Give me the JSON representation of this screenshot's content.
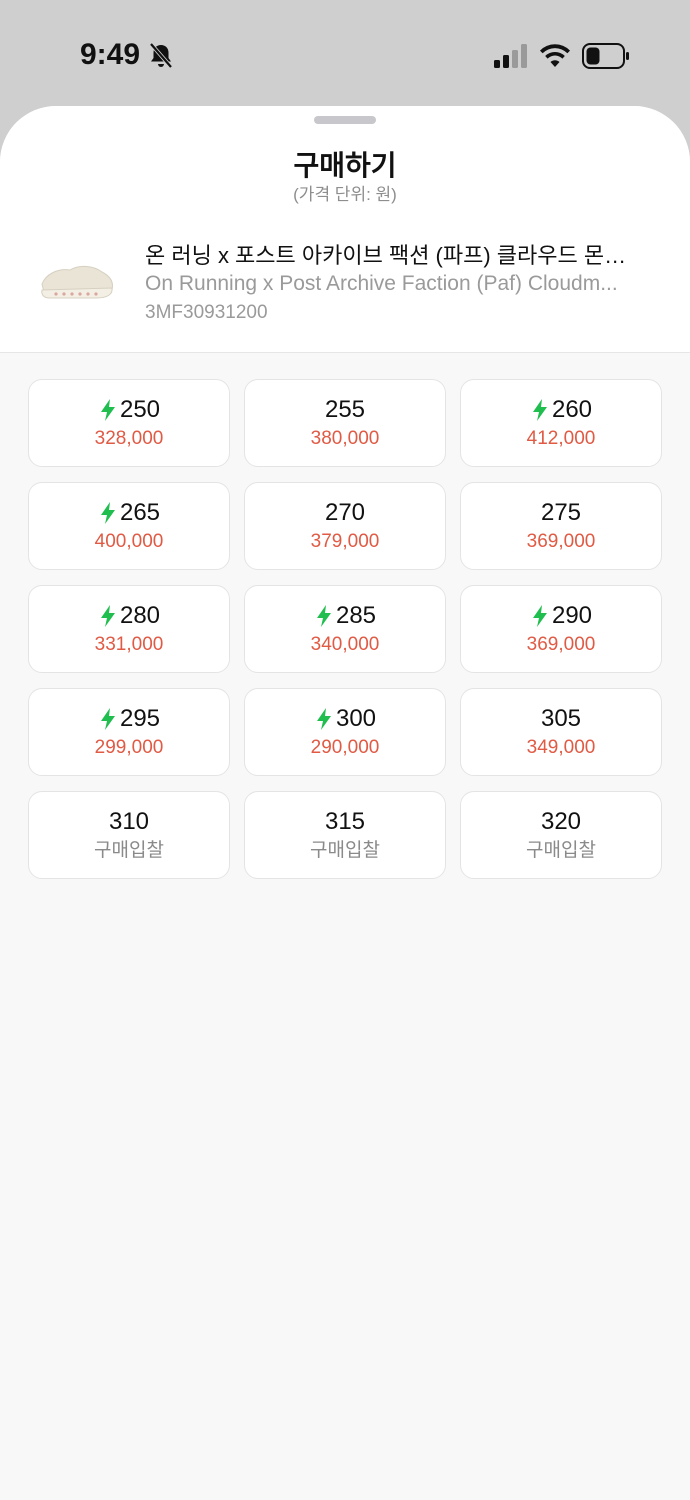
{
  "status": {
    "time": "9:49"
  },
  "sheet": {
    "title": "구매하기",
    "subtitle": "(가격 단위: 원)"
  },
  "product": {
    "name_ko": "온 러닝 x 포스트 아카이브 팩션 (파프) 클라우드 몬…",
    "name_en": "On Running x Post Archive Faction (Paf) Cloudm...",
    "code": "3MF30931200"
  },
  "colors": {
    "price": "#e05a44",
    "bolt": "#1fbe4e",
    "bid": "#8a8a8a"
  },
  "sizes": [
    {
      "size": "250",
      "price": "328,000",
      "express": true
    },
    {
      "size": "255",
      "price": "380,000",
      "express": false
    },
    {
      "size": "260",
      "price": "412,000",
      "express": true
    },
    {
      "size": "265",
      "price": "400,000",
      "express": true
    },
    {
      "size": "270",
      "price": "379,000",
      "express": false
    },
    {
      "size": "275",
      "price": "369,000",
      "express": false
    },
    {
      "size": "280",
      "price": "331,000",
      "express": true
    },
    {
      "size": "285",
      "price": "340,000",
      "express": true
    },
    {
      "size": "290",
      "price": "369,000",
      "express": true
    },
    {
      "size": "295",
      "price": "299,000",
      "express": true
    },
    {
      "size": "300",
      "price": "290,000",
      "express": true
    },
    {
      "size": "305",
      "price": "349,000",
      "express": false
    },
    {
      "size": "310",
      "price": "구매입찰",
      "express": false,
      "bid": true
    },
    {
      "size": "315",
      "price": "구매입찰",
      "express": false,
      "bid": true
    },
    {
      "size": "320",
      "price": "구매입찰",
      "express": false,
      "bid": true
    }
  ]
}
